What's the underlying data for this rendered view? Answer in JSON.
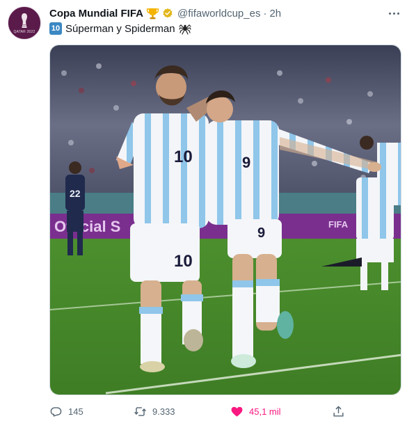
{
  "tweet": {
    "display_name": "Copa Mundial FIFA",
    "handle": "@fifaworldcup_es",
    "separator": "·",
    "time": "2h",
    "number_emoji": "10",
    "text": "Súperman y Spiderman",
    "avatar_caption": "QATAR 2022",
    "image_banner_text": "Official S",
    "image_banner_right": "FIFA",
    "jersey_numbers": [
      "10",
      "9",
      "22"
    ]
  },
  "actions": {
    "reply_count": "145",
    "retweet_count": "9.333",
    "like_count": "45,1 mil"
  },
  "colors": {
    "like": "#f91880",
    "secondary_text": "#536471",
    "verified": "#e2b719",
    "argentina_sky": "#8fc6ea"
  },
  "icons": {
    "avatar": "world-cup-trophy-logo",
    "trophy": "trophy-emoji",
    "verified": "verified-badge-icon",
    "more": "more-options-icon",
    "number": "keycap-ten-emoji",
    "spider": "spider-emoji",
    "reply": "reply-icon",
    "retweet": "retweet-icon",
    "like": "heart-icon",
    "share": "share-icon"
  }
}
